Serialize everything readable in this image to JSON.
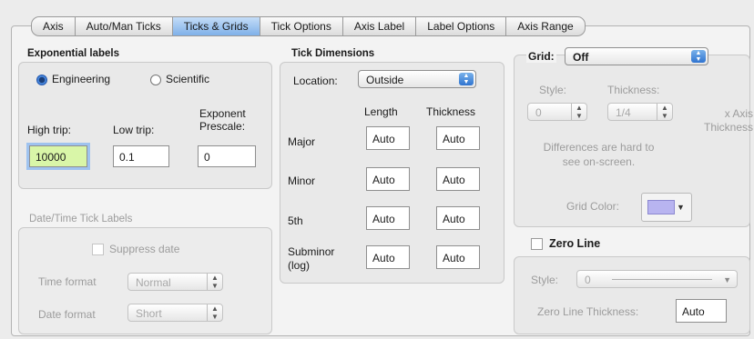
{
  "tabs": [
    "Axis",
    "Auto/Man Ticks",
    "Ticks & Grids",
    "Tick Options",
    "Axis Label",
    "Label Options",
    "Axis Range"
  ],
  "active_tab": "Ticks & Grids",
  "exponential": {
    "title": "Exponential labels",
    "engineering": "Engineering",
    "scientific": "Scientific",
    "high_trip_label": "High trip:",
    "low_trip_label": "Low trip:",
    "prescale_label_1": "Exponent",
    "prescale_label_2": "Prescale:",
    "high_trip": "10000",
    "low_trip": "0.1",
    "prescale": "0"
  },
  "datetime": {
    "title": "Date/Time Tick Labels",
    "suppress": "Suppress date",
    "time_format_label": "Time format",
    "time_format": "Normal",
    "date_format_label": "Date format",
    "date_format": "Short"
  },
  "tick_dim": {
    "title": "Tick Dimensions",
    "location_label": "Location:",
    "location": "Outside",
    "length_header": "Length",
    "thickness_header": "Thickness",
    "rows": [
      {
        "label": "Major",
        "length": "Auto",
        "thickness": "Auto"
      },
      {
        "label": "Minor",
        "length": "Auto",
        "thickness": "Auto"
      },
      {
        "label": "5th",
        "length": "Auto",
        "thickness": "Auto"
      },
      {
        "label_1": "Subminor",
        "label_2": "(log)",
        "length": "Auto",
        "thickness": "Auto"
      }
    ]
  },
  "grid": {
    "label": "Grid:",
    "value": "Off",
    "style_label": "Style:",
    "style_value": "0",
    "thickness_label": "Thickness:",
    "thickness_value": "1/4",
    "x_axis_1": "x Axis",
    "x_axis_2": "Thickness",
    "note_1": "Differences are hard to",
    "note_2": "see on-screen.",
    "color_label": "Grid Color:",
    "swatch_color": "#b8b4f0"
  },
  "zero_line": {
    "label": "Zero Line",
    "style_label": "Style:",
    "style_value": "0",
    "thickness_label": "Zero Line Thickness:",
    "thickness_value": "Auto"
  },
  "icons": {
    "popup_arrows": "up-down-arrows-icon",
    "color_arrow": "chevron-down-icon"
  }
}
